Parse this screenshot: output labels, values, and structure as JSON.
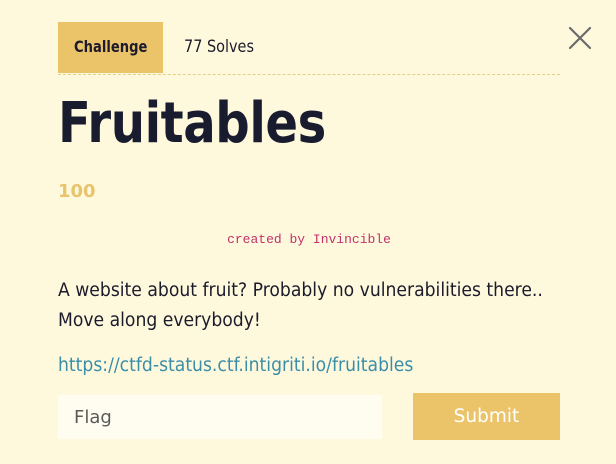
{
  "tabs": {
    "challenge_label": "Challenge",
    "solves_label": "77 Solves"
  },
  "challenge": {
    "name": "Fruitables",
    "points": "100",
    "author": "created by Invincible",
    "description_lines": [
      "A website about fruit? Probably no vulnerabilities there..",
      "Move along everybody!"
    ],
    "url": "https://ctfd-status.ctf.intigriti.io/fruitables"
  },
  "form": {
    "flag_placeholder": "Flag",
    "submit_label": "Submit"
  },
  "icons": {
    "close": "close-icon"
  },
  "colors": {
    "background": "#fef8dd",
    "accent": "#ebc46a",
    "points": "#e8c46e",
    "author": "#c1326a",
    "link": "#3b8ea8",
    "text": "#1b1b2b"
  }
}
